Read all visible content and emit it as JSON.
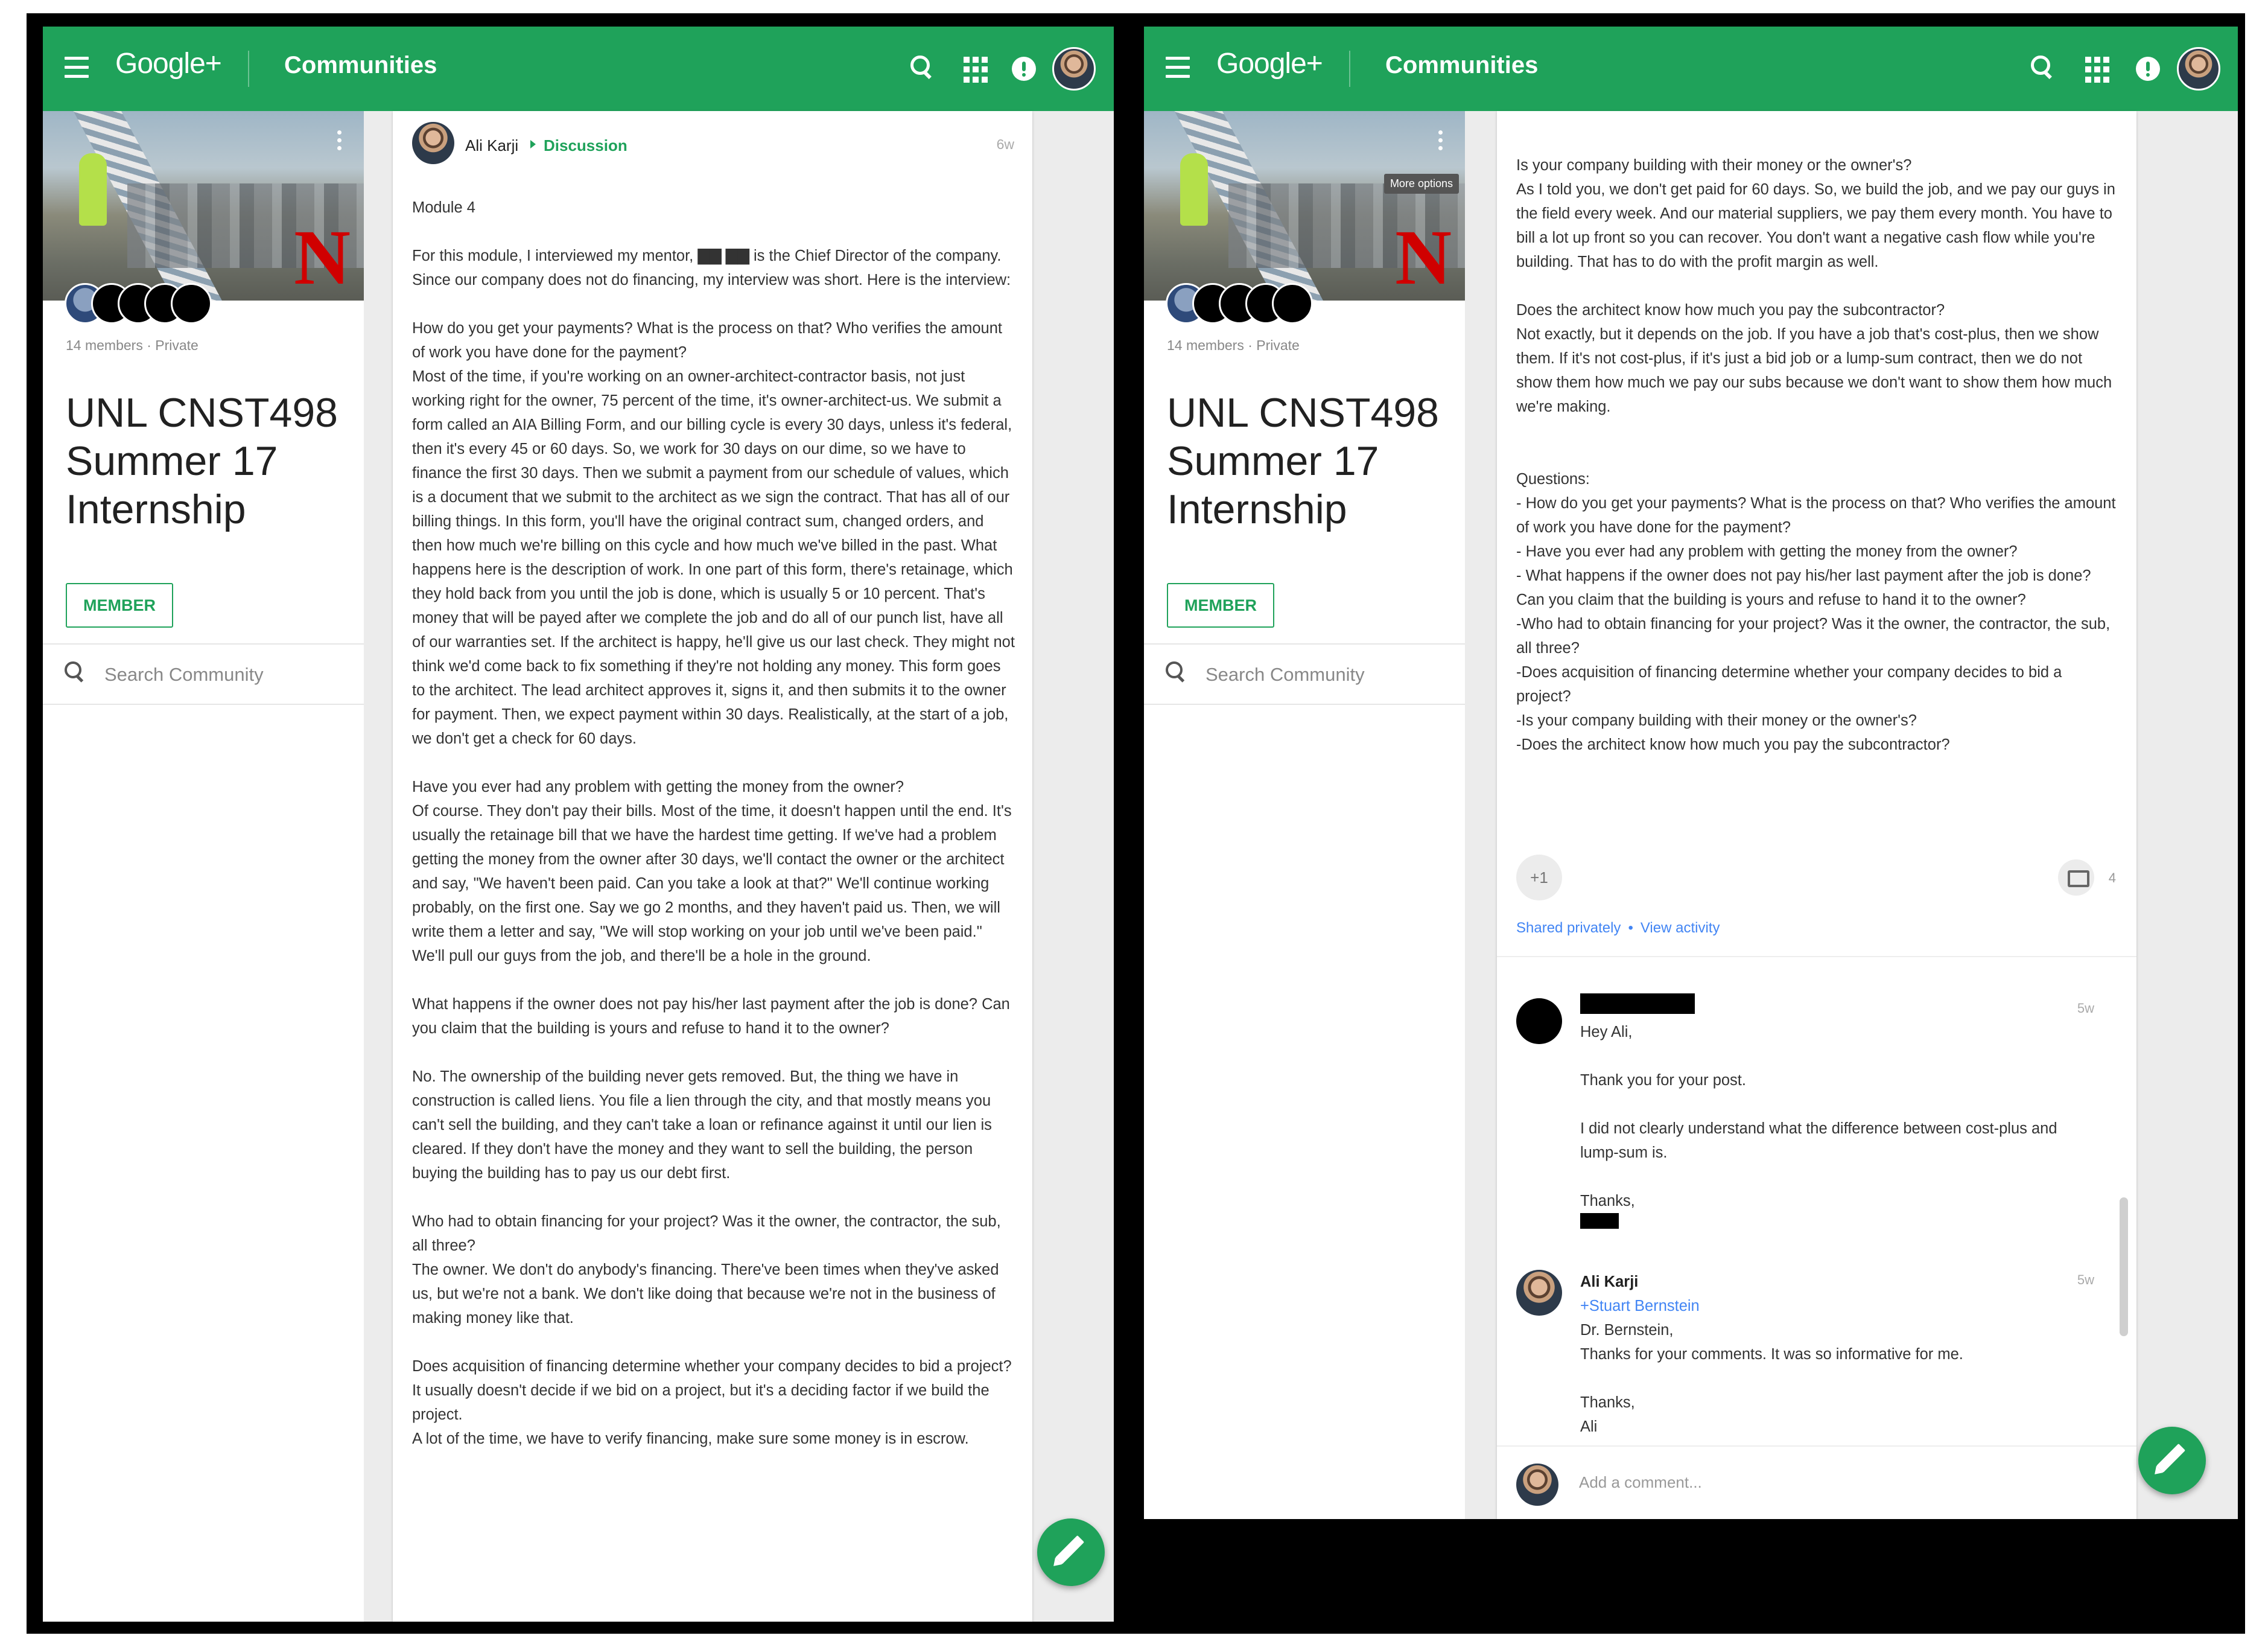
{
  "header": {
    "brand": "Google+",
    "section": "Communities"
  },
  "community": {
    "members_meta": "14 members · Private",
    "title": "UNL CNST498 Summer 17 Internship",
    "member_button": "MEMBER",
    "search_placeholder": "Search Community",
    "cover_logo_letter": "N",
    "more_options_tooltip": "More options"
  },
  "post": {
    "author": "Ali Karji",
    "category": "Discussion",
    "time": "6w",
    "paragraphs": [
      "Module 4",
      "For this module, I interviewed my mentor, ▇▇ ▇▇ is the Chief Director of the company. Since our company does not do financing, my interview was short. Here is the interview:",
      "How do you get your payments? What is the process on that? Who verifies the amount of work you have done for the payment?\nMost of the time, if you're working on an owner-architect-contractor basis, not just working right for the owner, 75 percent of the time, it's owner-architect-us. We submit a form called an AIA Billing Form, and our billing cycle is every 30 days, unless it's federal, then it's every 45 or 60 days. So, we work for 30 days on our dime, so we have to finance the first 30 days. Then we submit a payment from our schedule of values, which is a document that we submit to the architect as we sign the contract. That has all of our billing things. In this form, you'll have the original contract sum, changed orders, and then how much we're billing on this cycle and how much we've billed in the past. What happens here is the description of work. In one part of this form, there's retainage, which they hold back from you until the job is done, which is usually 5 or 10 percent. That's money that will be payed after we complete the job and do all of our punch list, have all of our warranties set. If the architect is happy, he'll give us our last check. They might not think we'd come back to fix something if they're not holding any money. This form goes to the architect. The lead architect approves it, signs it, and then submits it to the owner for payment. Then, we expect payment within 30 days. Realistically, at the start of a job, we don't get a check for 60 days.",
      "Have you ever had any problem with getting the money from the owner?\nOf course. They don't pay their bills. Most of the time, it doesn't happen until the end. It's usually the retainage bill that we have the hardest time getting. If we've had a problem getting the money from the owner after 30 days, we'll contact the owner or the architect and say, \"We haven't been paid. Can you take a look at that?\" We'll continue working probably, on the first one. Say we go 2 months, and they haven't paid us. Then, we will write them a letter and say, \"We will stop working on your job until we've been paid.\" We'll pull our guys from the job, and there'll be a hole in the ground.",
      "What happens if the owner does not pay his/her last payment after the job is done? Can you claim that the building is yours and refuse to hand it to the owner?",
      "No. The ownership of the building never gets removed. But, the thing we have in construction is called liens. You file a lien through the city, and that mostly means you can't sell the building, and they can't take a loan or refinance against it until our lien is cleared. If they don't have the money and they want to sell the building, the person buying the building has to pay us our debt first.",
      "Who had to obtain financing for your project?  Was it the owner, the contractor, the sub, all three?\nThe owner. We don't do anybody's financing. There've been times when they've asked us, but we're not a bank. We don't like doing that because we're not in the business of making money like that.",
      "Does acquisition of financing determine whether your company decides to bid a project?\nIt usually doesn't decide if we bid on a project, but it's a deciding factor if we build the project.\nA lot of the time, we have to verify financing, make sure some money is in escrow."
    ]
  },
  "thread": {
    "paragraphs": [
      "Is your company building with their money or the owner's?\nAs I told you, we don't get paid for 60 days. So, we build the job, and we pay our guys in the field every week. And our material suppliers, we pay them every month. You have to bill a lot up front so you can recover. You don't want a negative cash flow while you're building. That has to do with the profit margin as well.",
      "Does the architect know how much you pay the subcontractor?\nNot exactly, but it depends on the job. If you have a job that's cost-plus, then we show them. If it's not cost-plus, if it's just a bid job or a lump-sum contract, then we do not show them how much we pay our subs because we don't want to show them how much we're making.",
      "\nQuestions:\n- How do you get your payments? What is the process on that? Who verifies the amount of work you have done for the payment?\n- Have you ever had any problem with getting the money from the owner?\n- What happens if the owner does not pay his/her last payment after the job is done? Can you claim that the building is yours and refuse to hand it to the owner?\n-Who had to obtain financing for your project?  Was it the owner, the contractor, the sub, all three?\n-Does acquisition of financing determine whether your company decides to bid a project?\n-Is your company building with their money or the owner's?\n-Does the architect know how much you pay the subcontractor?"
    ],
    "plus_one": "+1",
    "comment_count": "4",
    "shared_privately": "Shared privately",
    "separator": "•",
    "view_activity": "View activity",
    "comments": [
      {
        "time": "5w",
        "text": "Hey Ali,\n\nThank you for your post.\n\nI did not clearly understand what the difference between cost-plus and lump-sum is.\n\nThanks,"
      },
      {
        "name": "Ali Karji",
        "time": "5w",
        "mention": "+Stuart Bernstein",
        "text": "Dr. Bernstein,\nThanks for your comments. It was so informative for me.\n\nThanks,\nAli"
      }
    ],
    "add_comment_placeholder": "Add a comment..."
  }
}
